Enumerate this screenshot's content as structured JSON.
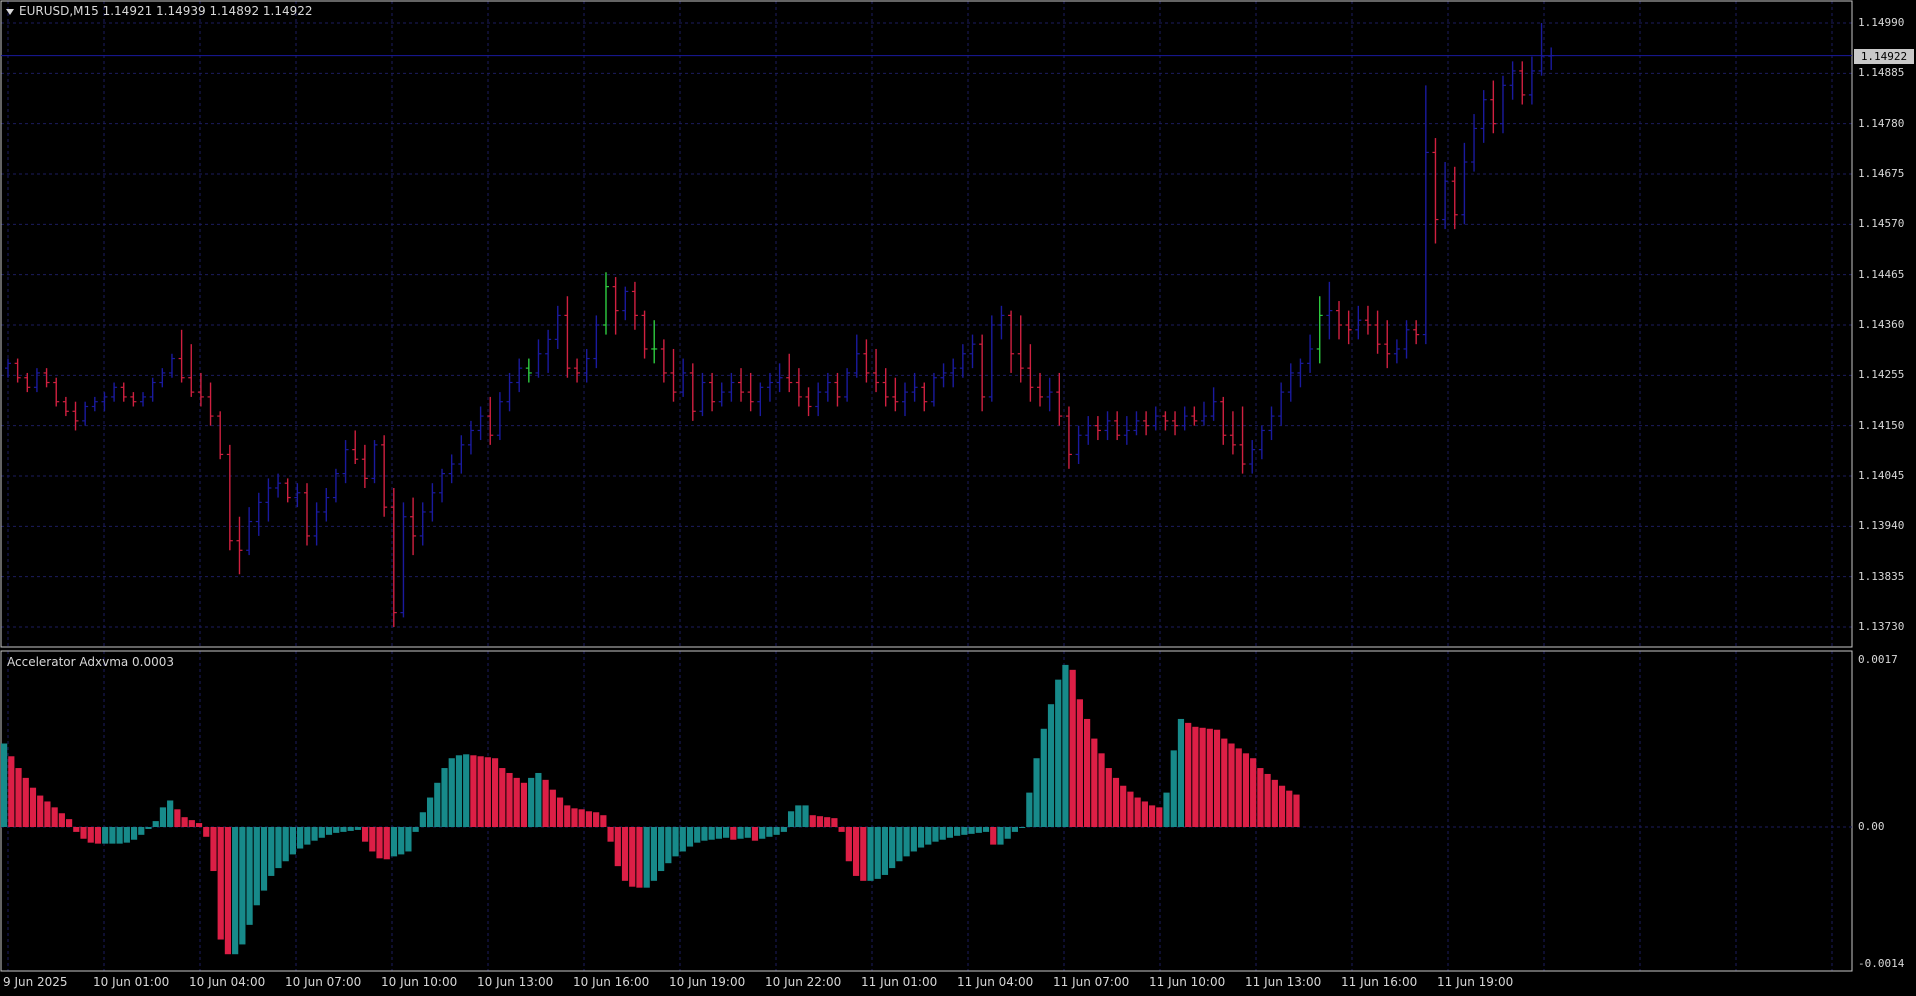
{
  "symbol_header": "EURUSD,M15  1.14921 1.14939 1.14892 1.14922",
  "indicator_header": "Accelerator Adxvma  0.0003",
  "current_price": "1.14922",
  "price_axis": {
    "min": 1.1373,
    "max": 1.1499,
    "labels": [
      "1.14990",
      "1.14885",
      "1.14780",
      "1.14675",
      "1.14570",
      "1.14465",
      "1.14360",
      "1.14255",
      "1.14150",
      "1.14045",
      "1.13940",
      "1.13835",
      "1.13730"
    ]
  },
  "indicator_axis": {
    "labels": [
      "0.0017",
      "0.00",
      "-0.0014"
    ]
  },
  "time_axis": {
    "labels": [
      "9 Jun 2025",
      "10 Jun 01:00",
      "10 Jun 04:00",
      "10 Jun 07:00",
      "10 Jun 10:00",
      "10 Jun 13:00",
      "10 Jun 16:00",
      "10 Jun 19:00",
      "10 Jun 22:00",
      "11 Jun 01:00",
      "11 Jun 04:00",
      "11 Jun 07:00",
      "11 Jun 10:00",
      "11 Jun 13:00",
      "11 Jun 16:00",
      "11 Jun 19:00"
    ]
  },
  "colors": {
    "background": "#000000",
    "grid": "#1c1c5e",
    "bull_bar": "#1a1a9e",
    "bear_bar": "#d02040",
    "doji_bar": "#2ecc40",
    "ind_up": "#178a8a",
    "ind_down": "#dc1f46",
    "text": "#d8d8d8",
    "price_line": "#1a1a9e"
  },
  "chart_data": {
    "type": "ohlc",
    "timeframe": "M15",
    "price_ylim": [
      1.1373,
      1.1499
    ],
    "ohlc": [
      [
        1.1427,
        1.1429,
        1.1425,
        1.1428
      ],
      [
        1.1428,
        1.1429,
        1.1424,
        1.1425
      ],
      [
        1.1425,
        1.1426,
        1.1422,
        1.1423
      ],
      [
        1.1423,
        1.1427,
        1.1422,
        1.1426
      ],
      [
        1.1426,
        1.1427,
        1.1423,
        1.1424
      ],
      [
        1.1424,
        1.1425,
        1.1419,
        1.142
      ],
      [
        1.142,
        1.1421,
        1.1417,
        1.1418
      ],
      [
        1.1418,
        1.142,
        1.1414,
        1.1416
      ],
      [
        1.1416,
        1.142,
        1.1415,
        1.1419
      ],
      [
        1.1419,
        1.1421,
        1.1418,
        1.142
      ],
      [
        1.142,
        1.1422,
        1.1418,
        1.1421
      ],
      [
        1.1421,
        1.1424,
        1.142,
        1.1423
      ],
      [
        1.1423,
        1.1424,
        1.142,
        1.1421
      ],
      [
        1.1421,
        1.1422,
        1.1419,
        1.142
      ],
      [
        1.142,
        1.1422,
        1.1419,
        1.1421
      ],
      [
        1.1421,
        1.1425,
        1.142,
        1.1424
      ],
      [
        1.1424,
        1.1427,
        1.1423,
        1.1426
      ],
      [
        1.1426,
        1.143,
        1.1425,
        1.1429
      ],
      [
        1.1429,
        1.1435,
        1.1424,
        1.1425
      ],
      [
        1.1425,
        1.1432,
        1.1421,
        1.1422
      ],
      [
        1.1422,
        1.1426,
        1.1419,
        1.1421
      ],
      [
        1.1421,
        1.1424,
        1.1415,
        1.1417
      ],
      [
        1.1417,
        1.1418,
        1.1408,
        1.1409
      ],
      [
        1.1409,
        1.1411,
        1.1389,
        1.1391
      ],
      [
        1.1391,
        1.1396,
        1.1384,
        1.1389
      ],
      [
        1.1389,
        1.1398,
        1.1388,
        1.1395
      ],
      [
        1.1395,
        1.1401,
        1.1392,
        1.1399
      ],
      [
        1.1399,
        1.1404,
        1.1395,
        1.1402
      ],
      [
        1.1402,
        1.1405,
        1.14,
        1.1403
      ],
      [
        1.1403,
        1.1404,
        1.1399,
        1.14
      ],
      [
        1.14,
        1.1403,
        1.1398,
        1.1401
      ],
      [
        1.1401,
        1.1403,
        1.139,
        1.1392
      ],
      [
        1.1392,
        1.1399,
        1.139,
        1.1397
      ],
      [
        1.1397,
        1.1402,
        1.1395,
        1.14
      ],
      [
        1.14,
        1.1406,
        1.1399,
        1.1405
      ],
      [
        1.1405,
        1.1412,
        1.1403,
        1.141
      ],
      [
        1.141,
        1.1414,
        1.1407,
        1.1408
      ],
      [
        1.1408,
        1.1411,
        1.1402,
        1.1404
      ],
      [
        1.1404,
        1.1412,
        1.1403,
        1.1411
      ],
      [
        1.1411,
        1.1413,
        1.1396,
        1.1398
      ],
      [
        1.1398,
        1.1402,
        1.1373,
        1.1376
      ],
      [
        1.1376,
        1.1399,
        1.1375,
        1.1396
      ],
      [
        1.1396,
        1.14,
        1.1388,
        1.1392
      ],
      [
        1.1392,
        1.1399,
        1.139,
        1.1397
      ],
      [
        1.1397,
        1.1403,
        1.1395,
        1.1401
      ],
      [
        1.1401,
        1.1406,
        1.1399,
        1.1405
      ],
      [
        1.1405,
        1.1409,
        1.1403,
        1.1407
      ],
      [
        1.1407,
        1.1413,
        1.1405,
        1.1411
      ],
      [
        1.1411,
        1.1416,
        1.1409,
        1.1414
      ],
      [
        1.1414,
        1.1419,
        1.1412,
        1.1417
      ],
      [
        1.1417,
        1.1421,
        1.1411,
        1.1413
      ],
      [
        1.1413,
        1.1422,
        1.1412,
        1.142
      ],
      [
        1.142,
        1.1426,
        1.1418,
        1.1424
      ],
      [
        1.1424,
        1.1429,
        1.1422,
        1.1427
      ],
      [
        1.1427,
        1.1429,
        1.1424,
        1.1426
      ],
      [
        1.1426,
        1.1433,
        1.1425,
        1.143
      ],
      [
        1.143,
        1.1435,
        1.1426,
        1.1433
      ],
      [
        1.1433,
        1.144,
        1.1431,
        1.1438
      ],
      [
        1.1438,
        1.1442,
        1.1425,
        1.1427
      ],
      [
        1.1427,
        1.1429,
        1.1424,
        1.1426
      ],
      [
        1.1426,
        1.1431,
        1.1424,
        1.1429
      ],
      [
        1.1429,
        1.1438,
        1.1427,
        1.1436
      ],
      [
        1.1436,
        1.1447,
        1.1434,
        1.1444
      ],
      [
        1.1444,
        1.1446,
        1.1434,
        1.1439
      ],
      [
        1.1439,
        1.1444,
        1.1437,
        1.1443
      ],
      [
        1.1443,
        1.1445,
        1.1435,
        1.1438
      ],
      [
        1.1438,
        1.1439,
        1.1429,
        1.1431
      ],
      [
        1.1431,
        1.1437,
        1.1428,
        1.1431
      ],
      [
        1.1431,
        1.1433,
        1.1424,
        1.1426
      ],
      [
        1.1426,
        1.1431,
        1.142,
        1.1422
      ],
      [
        1.1422,
        1.1429,
        1.1421,
        1.1426
      ],
      [
        1.1426,
        1.1428,
        1.1416,
        1.1418
      ],
      [
        1.1418,
        1.1426,
        1.1417,
        1.1424
      ],
      [
        1.1424,
        1.1426,
        1.1418,
        1.142
      ],
      [
        1.142,
        1.1424,
        1.1419,
        1.1422
      ],
      [
        1.1422,
        1.1426,
        1.142,
        1.1424
      ],
      [
        1.1424,
        1.1427,
        1.142,
        1.1422
      ],
      [
        1.1422,
        1.1426,
        1.1418,
        1.142
      ],
      [
        1.142,
        1.1424,
        1.1417,
        1.1423
      ],
      [
        1.1423,
        1.1426,
        1.142,
        1.1424
      ],
      [
        1.1424,
        1.1428,
        1.1422,
        1.1425
      ],
      [
        1.1425,
        1.143,
        1.1422,
        1.1424
      ],
      [
        1.1424,
        1.1427,
        1.1419,
        1.1421
      ],
      [
        1.1421,
        1.1423,
        1.1417,
        1.1419
      ],
      [
        1.1419,
        1.1424,
        1.1417,
        1.1422
      ],
      [
        1.1422,
        1.1426,
        1.142,
        1.1424
      ],
      [
        1.1424,
        1.1426,
        1.1419,
        1.1421
      ],
      [
        1.1421,
        1.1427,
        1.142,
        1.1426
      ],
      [
        1.1426,
        1.1434,
        1.1425,
        1.143
      ],
      [
        1.143,
        1.1433,
        1.1424,
        1.1426
      ],
      [
        1.1426,
        1.1431,
        1.1422,
        1.1424
      ],
      [
        1.1424,
        1.1427,
        1.1419,
        1.1421
      ],
      [
        1.1421,
        1.1425,
        1.1418,
        1.142
      ],
      [
        1.142,
        1.1424,
        1.1417,
        1.1422
      ],
      [
        1.1422,
        1.1426,
        1.142,
        1.1423
      ],
      [
        1.1423,
        1.1424,
        1.1418,
        1.142
      ],
      [
        1.142,
        1.1426,
        1.1419,
        1.1425
      ],
      [
        1.1425,
        1.1428,
        1.1423,
        1.1426
      ],
      [
        1.1426,
        1.1429,
        1.1423,
        1.1427
      ],
      [
        1.1427,
        1.1432,
        1.1425,
        1.143
      ],
      [
        1.143,
        1.1434,
        1.1427,
        1.1432
      ],
      [
        1.1432,
        1.1434,
        1.1418,
        1.1421
      ],
      [
        1.1421,
        1.1438,
        1.142,
        1.1436
      ],
      [
        1.1436,
        1.144,
        1.1433,
        1.1438
      ],
      [
        1.1438,
        1.1439,
        1.1426,
        1.143
      ],
      [
        1.143,
        1.1438,
        1.1424,
        1.1427
      ],
      [
        1.1427,
        1.1432,
        1.142,
        1.1423
      ],
      [
        1.1423,
        1.1426,
        1.1419,
        1.1421
      ],
      [
        1.1421,
        1.1425,
        1.1418,
        1.1422
      ],
      [
        1.1422,
        1.1426,
        1.1415,
        1.1417
      ],
      [
        1.1417,
        1.1419,
        1.1406,
        1.1409
      ],
      [
        1.1409,
        1.1415,
        1.1407,
        1.1413
      ],
      [
        1.1413,
        1.1417,
        1.1411,
        1.1415
      ],
      [
        1.1415,
        1.1417,
        1.1412,
        1.1414
      ],
      [
        1.1414,
        1.1418,
        1.1412,
        1.1416
      ],
      [
        1.1416,
        1.1418,
        1.1412,
        1.1413
      ],
      [
        1.1413,
        1.1417,
        1.1411,
        1.1414
      ],
      [
        1.1414,
        1.1418,
        1.1413,
        1.1416
      ],
      [
        1.1416,
        1.1418,
        1.1413,
        1.1415
      ],
      [
        1.1415,
        1.1419,
        1.1414,
        1.1417
      ],
      [
        1.1417,
        1.1418,
        1.1414,
        1.1416
      ],
      [
        1.1416,
        1.1418,
        1.1413,
        1.1415
      ],
      [
        1.1415,
        1.1419,
        1.1414,
        1.1417
      ],
      [
        1.1417,
        1.1419,
        1.1415,
        1.1416
      ],
      [
        1.1416,
        1.142,
        1.1415,
        1.1417
      ],
      [
        1.1417,
        1.1423,
        1.1416,
        1.142
      ],
      [
        1.142,
        1.1421,
        1.1411,
        1.1413
      ],
      [
        1.1413,
        1.1418,
        1.1409,
        1.1411
      ],
      [
        1.1411,
        1.1419,
        1.1405,
        1.1407
      ],
      [
        1.1407,
        1.1412,
        1.1405,
        1.141
      ],
      [
        1.141,
        1.1415,
        1.1408,
        1.1414
      ],
      [
        1.1414,
        1.1419,
        1.1412,
        1.1417
      ],
      [
        1.1417,
        1.1424,
        1.1415,
        1.1422
      ],
      [
        1.1422,
        1.1428,
        1.142,
        1.1426
      ],
      [
        1.1426,
        1.1429,
        1.1423,
        1.1428
      ],
      [
        1.1428,
        1.1434,
        1.1426,
        1.1431
      ],
      [
        1.1431,
        1.1442,
        1.1428,
        1.1438
      ],
      [
        1.1438,
        1.1445,
        1.1433,
        1.1439
      ],
      [
        1.1439,
        1.1441,
        1.1433,
        1.1436
      ],
      [
        1.1436,
        1.1439,
        1.1432,
        1.1435
      ],
      [
        1.1435,
        1.144,
        1.1433,
        1.1437
      ],
      [
        1.1437,
        1.144,
        1.1434,
        1.1436
      ],
      [
        1.1436,
        1.1439,
        1.143,
        1.1432
      ],
      [
        1.1432,
        1.1437,
        1.1427,
        1.143
      ],
      [
        1.143,
        1.1433,
        1.1428,
        1.1431
      ],
      [
        1.1431,
        1.1437,
        1.1429,
        1.1435
      ],
      [
        1.1435,
        1.1437,
        1.1432,
        1.1434
      ],
      [
        1.1434,
        1.1486,
        1.1432,
        1.1472
      ],
      [
        1.1472,
        1.1475,
        1.1453,
        1.1458
      ],
      [
        1.1458,
        1.147,
        1.1456,
        1.1466
      ],
      [
        1.1466,
        1.1469,
        1.1456,
        1.1459
      ],
      [
        1.1459,
        1.1474,
        1.1457,
        1.147
      ],
      [
        1.147,
        1.148,
        1.1468,
        1.1477
      ],
      [
        1.1477,
        1.1485,
        1.1474,
        1.1483
      ],
      [
        1.1483,
        1.1487,
        1.1476,
        1.1478
      ],
      [
        1.1478,
        1.1488,
        1.1476,
        1.1486
      ],
      [
        1.1486,
        1.1491,
        1.1483,
        1.1489
      ],
      [
        1.1489,
        1.1491,
        1.1482,
        1.1484
      ],
      [
        1.1484,
        1.1492,
        1.1482,
        1.1489
      ],
      [
        1.1489,
        1.1499,
        1.1488,
        1.14921
      ],
      [
        1.14921,
        1.14939,
        1.14892,
        1.14922
      ]
    ],
    "indicator": {
      "name": "Accelerator Adxvma",
      "value": 0.0003,
      "ylim": [
        -0.0014,
        0.0017
      ],
      "values": [
        0.00085,
        0.00072,
        0.0006,
        0.0005,
        0.0004,
        0.00032,
        0.00026,
        0.0002,
        0.00014,
        8e-05,
        -5e-05,
        -0.00012,
        -0.00016,
        -0.00017,
        -0.00017,
        -0.00017,
        -0.00017,
        -0.00016,
        -0.00013,
        -8e-05,
        -2e-05,
        6e-05,
        0.0002,
        0.00027,
        0.00018,
        0.0001,
        7e-05,
        4e-05,
        -0.0001,
        -0.00045,
        -0.00115,
        -0.0013,
        -0.0013,
        -0.0012,
        -0.001,
        -0.0008,
        -0.00065,
        -0.0005,
        -0.00042,
        -0.00035,
        -0.00028,
        -0.00022,
        -0.00018,
        -0.00014,
        -0.00011,
        -8e-05,
        -6e-05,
        -5e-05,
        -4e-05,
        -3e-05,
        -0.00015,
        -0.00025,
        -0.00032,
        -0.00033,
        -0.0003,
        -0.00028,
        -0.00025,
        -5e-05,
        0.00015,
        0.0003,
        0.00045,
        0.0006,
        0.0007,
        0.00073,
        0.00074,
        0.00073,
        0.00072,
        0.00071,
        0.0007,
        0.0006,
        0.00055,
        0.0005,
        0.00045,
        0.0005,
        0.00055,
        0.00048,
        0.00038,
        0.0003,
        0.00022,
        0.00019,
        0.00018,
        0.00016,
        0.00015,
        0.00012,
        -0.00015,
        -0.0004,
        -0.00055,
        -0.00061,
        -0.00062,
        -0.00062,
        -0.00055,
        -0.00045,
        -0.00037,
        -0.0003,
        -0.00025,
        -0.0002,
        -0.00016,
        -0.00014,
        -0.00013,
        -0.00012,
        -0.00011,
        -0.00013,
        -0.00012,
        -0.00011,
        -0.00014,
        -0.00012,
        -0.0001,
        -8e-05,
        -5e-05,
        0.00016,
        0.00022,
        0.00022,
        0.00012,
        0.00011,
        0.0001,
        9e-05,
        -5e-05,
        -0.00035,
        -0.0005,
        -0.00055,
        -0.00055,
        -0.00053,
        -0.00049,
        -0.00042,
        -0.00035,
        -0.0003,
        -0.00025,
        -0.00021,
        -0.00018,
        -0.00015,
        -0.00013,
        -0.00011,
        -9e-05,
        -8e-05,
        -7e-05,
        -6e-05,
        -5e-05,
        -0.00018,
        -0.00018,
        -0.00012,
        -5e-05,
        0.0,
        0.00035,
        0.0007,
        0.001,
        0.00125,
        0.0015,
        0.00165,
        0.0016,
        0.0013,
        0.0011,
        0.0009,
        0.00075,
        0.0006,
        0.0005,
        0.00042,
        0.00036,
        0.0003,
        0.00026,
        0.00022,
        0.0002,
        0.00035,
        0.00078,
        0.0011,
        0.00106,
        0.00102,
        0.00101,
        0.001,
        0.00099,
        0.0009,
        0.00085,
        0.0008,
        0.00075,
        0.0007,
        0.0006,
        0.00054,
        0.00048,
        0.00042,
        0.00037,
        0.00033
      ]
    }
  }
}
